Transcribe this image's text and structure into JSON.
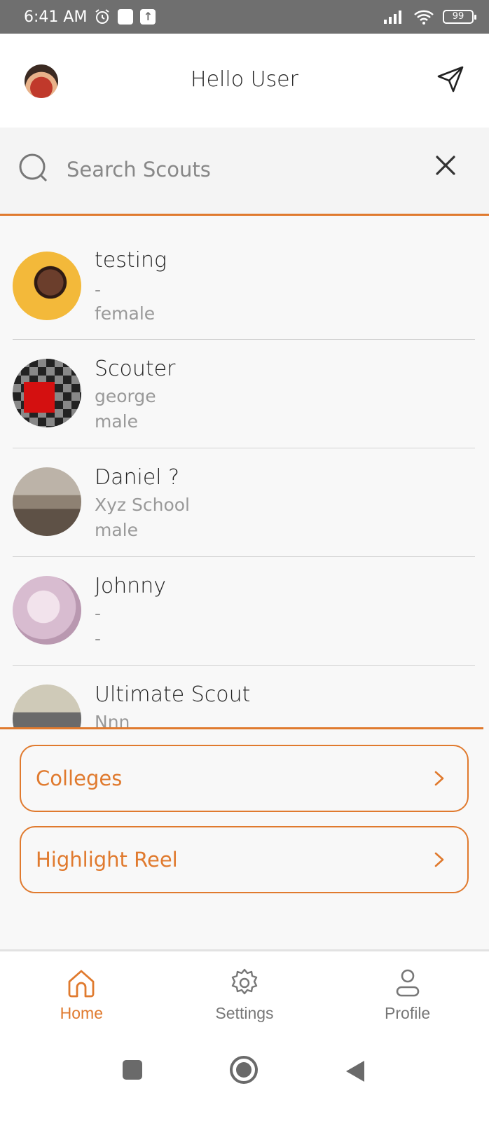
{
  "status_bar": {
    "time": "6:41 AM",
    "battery": "99",
    "icons": [
      "alarm-icon",
      "notification-square-icon",
      "upload-icon",
      "signal-icon",
      "wifi-icon",
      "battery-icon"
    ]
  },
  "header": {
    "title": "Hello User",
    "avatar_icon": "user-avatar",
    "action_icon": "send-icon"
  },
  "search": {
    "placeholder": "Search Scouts",
    "value": "",
    "icon": "search-icon",
    "clear_icon": "close-icon"
  },
  "scouts": [
    {
      "name": "testing",
      "line1": "-",
      "line2": "female"
    },
    {
      "name": "Scouter",
      "line1": "george",
      "line2": "male"
    },
    {
      "name": "Daniel ?",
      "line1": "Xyz School",
      "line2": "male"
    },
    {
      "name": "Johnny",
      "line1": "-",
      "line2": "-"
    },
    {
      "name": "Ultimate Scout",
      "line1": "Nnn",
      "line2": ""
    }
  ],
  "menu": [
    {
      "label": "Colleges",
      "icon": "chevron-right-icon"
    },
    {
      "label": "Highlight Reel",
      "icon": "chevron-right-icon"
    }
  ],
  "bottom_nav": [
    {
      "label": "Home",
      "icon": "home-icon",
      "active": true
    },
    {
      "label": "Settings",
      "icon": "gear-icon",
      "active": false
    },
    {
      "label": "Profile",
      "icon": "user-icon",
      "active": false
    }
  ],
  "system_nav": [
    "recents-square-icon",
    "home-circle-icon",
    "back-triangle-icon"
  ],
  "colors": {
    "accent": "#e07a2e",
    "status_bar": "#6f6f6f",
    "background": "#f8f8f8",
    "text": "#222222",
    "muted": "#999999"
  }
}
